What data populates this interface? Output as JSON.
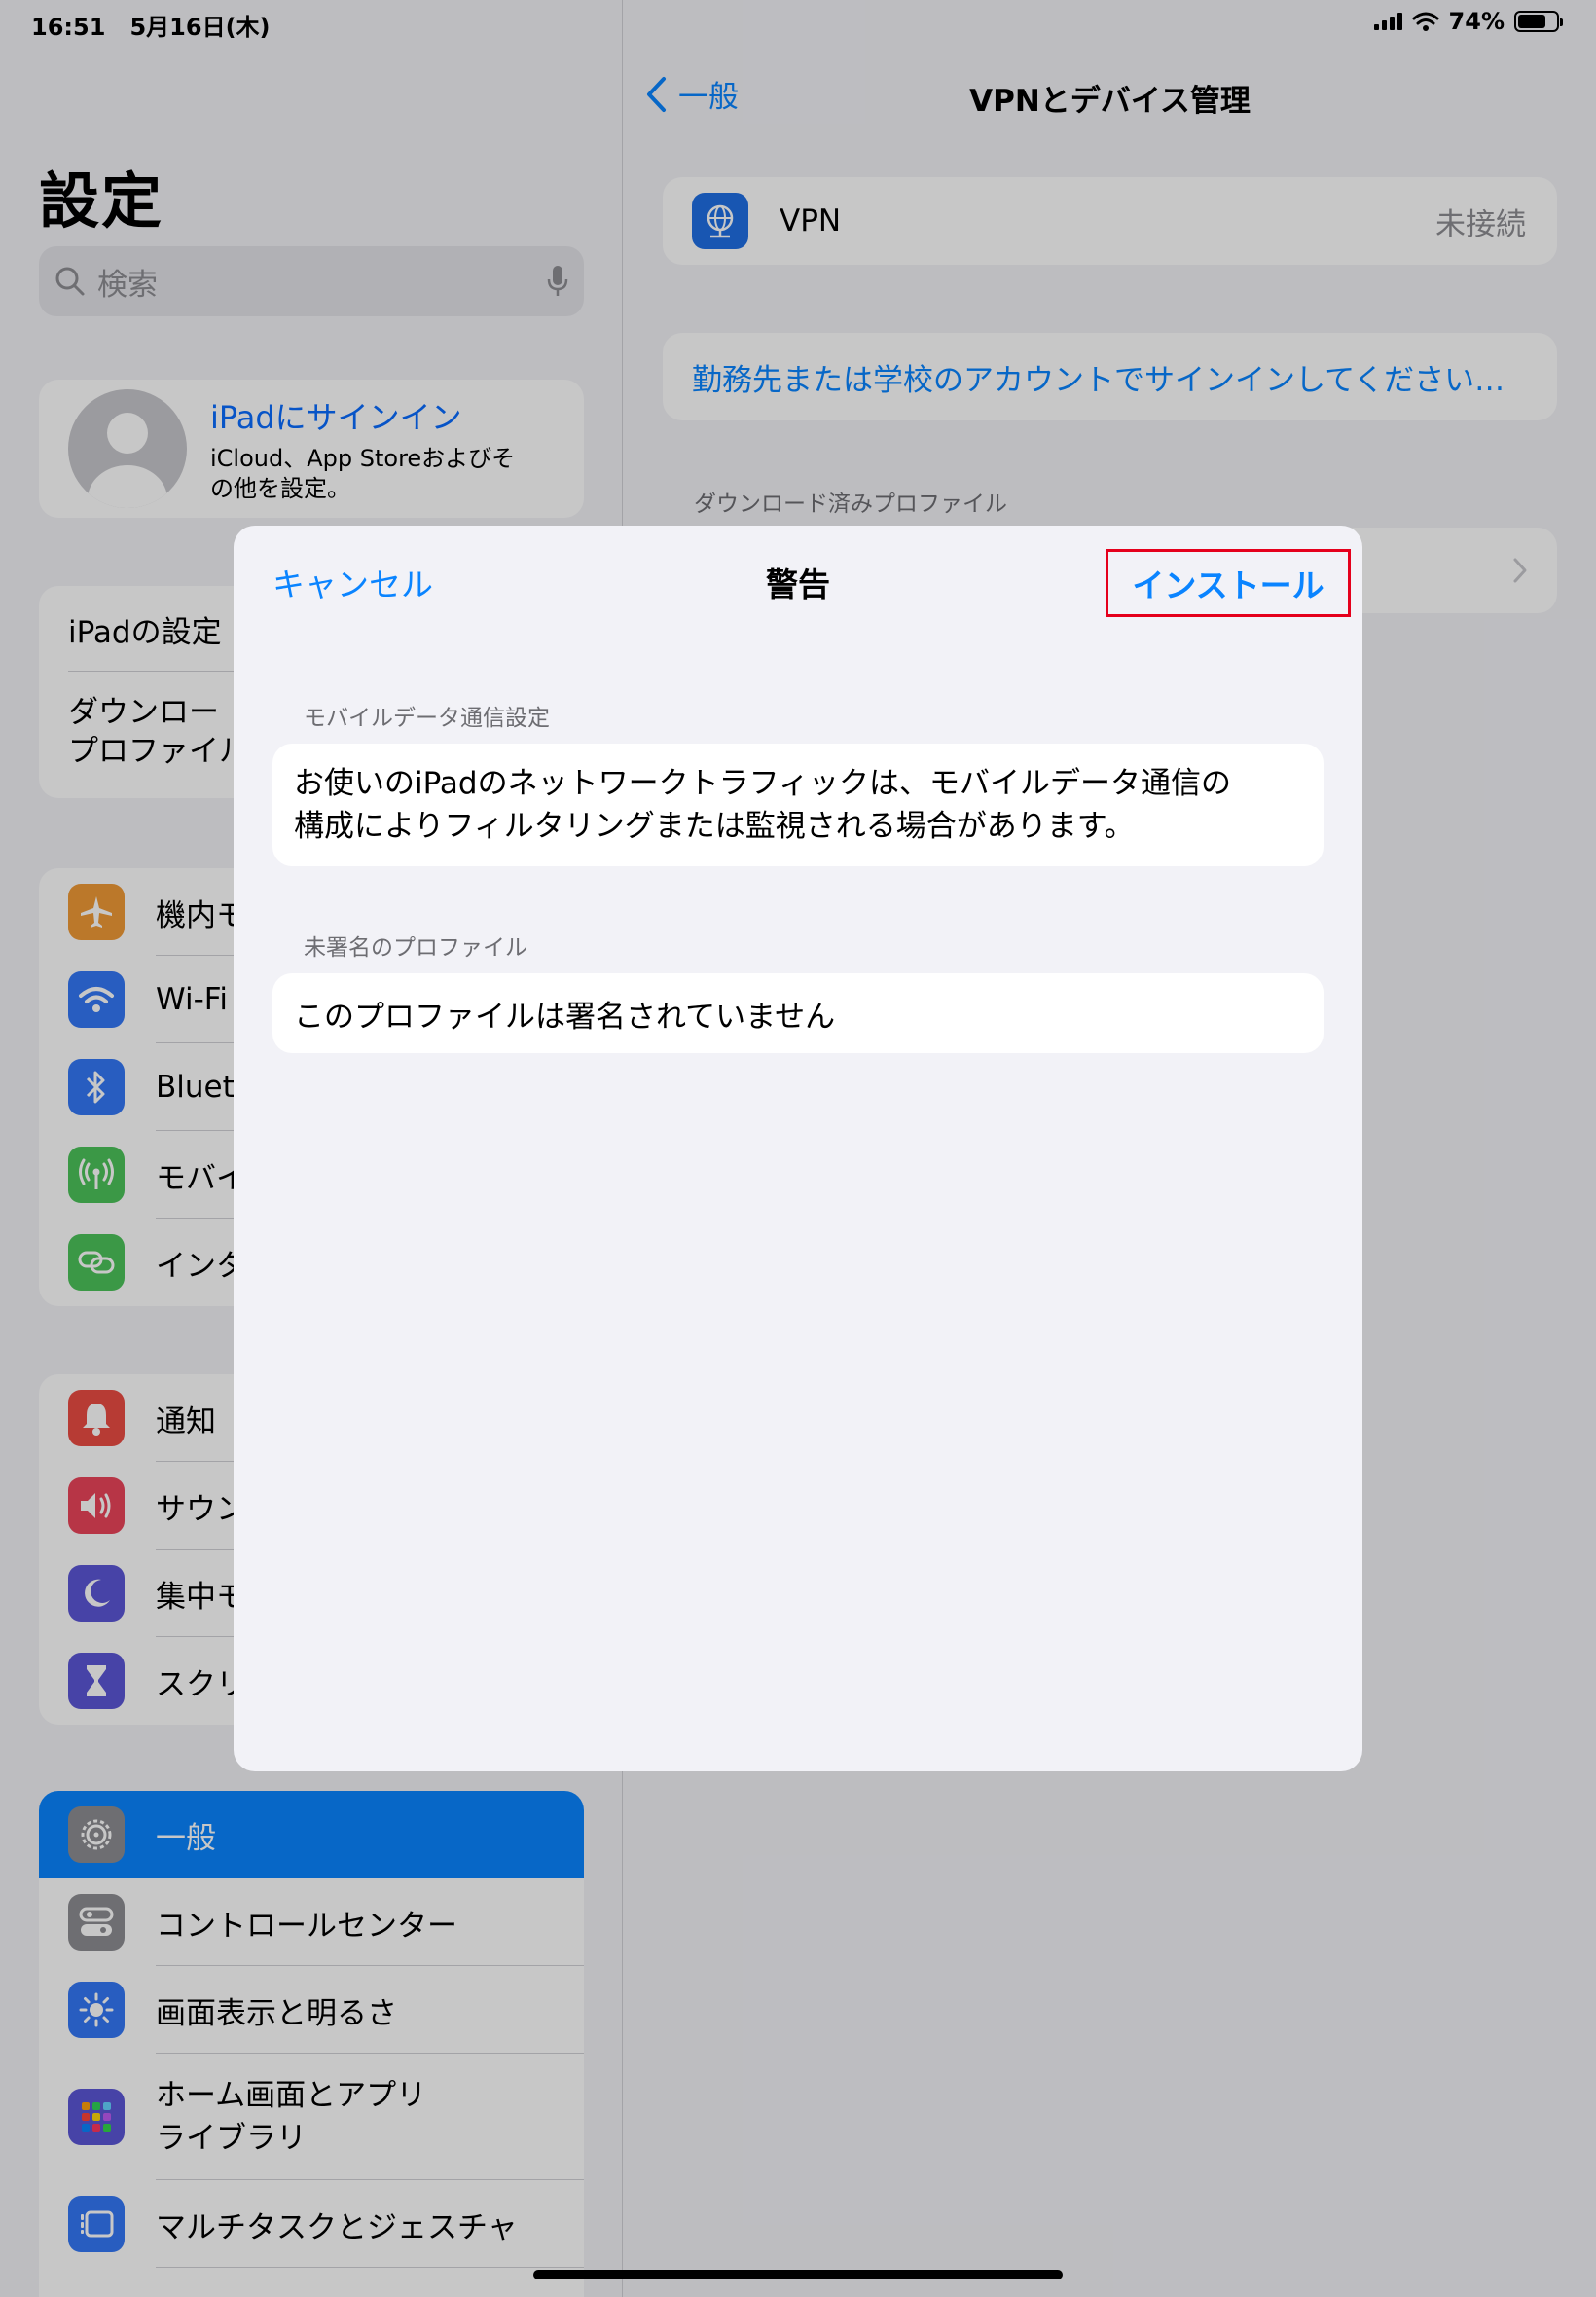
{
  "status_bar": {
    "time": "16:51",
    "date": "5月16日(木)",
    "battery": "74%",
    "battery_level": 0.74
  },
  "sidebar": {
    "title": "設定",
    "search_placeholder": "検索",
    "profile": {
      "name": "iPadにサインイン",
      "subtitle_line1": "iCloud、App Storeおよびそ",
      "subtitle_line2": "の他を設定。"
    },
    "group_ipad": {
      "item1": "iPadの設定",
      "item2_line1": "ダウンロー",
      "item2_line2": "プロファイル"
    },
    "group_connect": [
      "機内モ",
      "Wi-Fi",
      "Blueto",
      "モバイ",
      "インタ"
    ],
    "group_notify": [
      "通知",
      "サウン",
      "集中モ",
      "スクリ"
    ],
    "group_general": [
      "一般",
      "コントロールセンター",
      "画面表示と明るさ",
      "ホーム画面とアプリ",
      "ライブラリ",
      "マルチタスクとジェスチャ"
    ]
  },
  "detail": {
    "back_label": "一般",
    "title": "VPNとデバイス管理",
    "vpn_label": "VPN",
    "vpn_status": "未接続",
    "signin_text": "勤務先または学校のアカウントでサインインしてください…",
    "downloaded_header": "ダウンロード済みプロファイル"
  },
  "modal": {
    "cancel": "キャンセル",
    "title": "警告",
    "install": "インストール",
    "section1_header": "モバイルデータ通信設定",
    "section1_text_line1": "お使いのiPadのネットワークトラフィックは、モバイルデータ通信の",
    "section1_text_line2": "構成によりフィルタリングまたは監視される場合があります。",
    "section2_header": "未署名のプロファイル",
    "section2_text": "このプロファイルは署名されていません"
  },
  "colors": {
    "accent": "#0a84ff",
    "highlight_box": "#e5001c"
  }
}
